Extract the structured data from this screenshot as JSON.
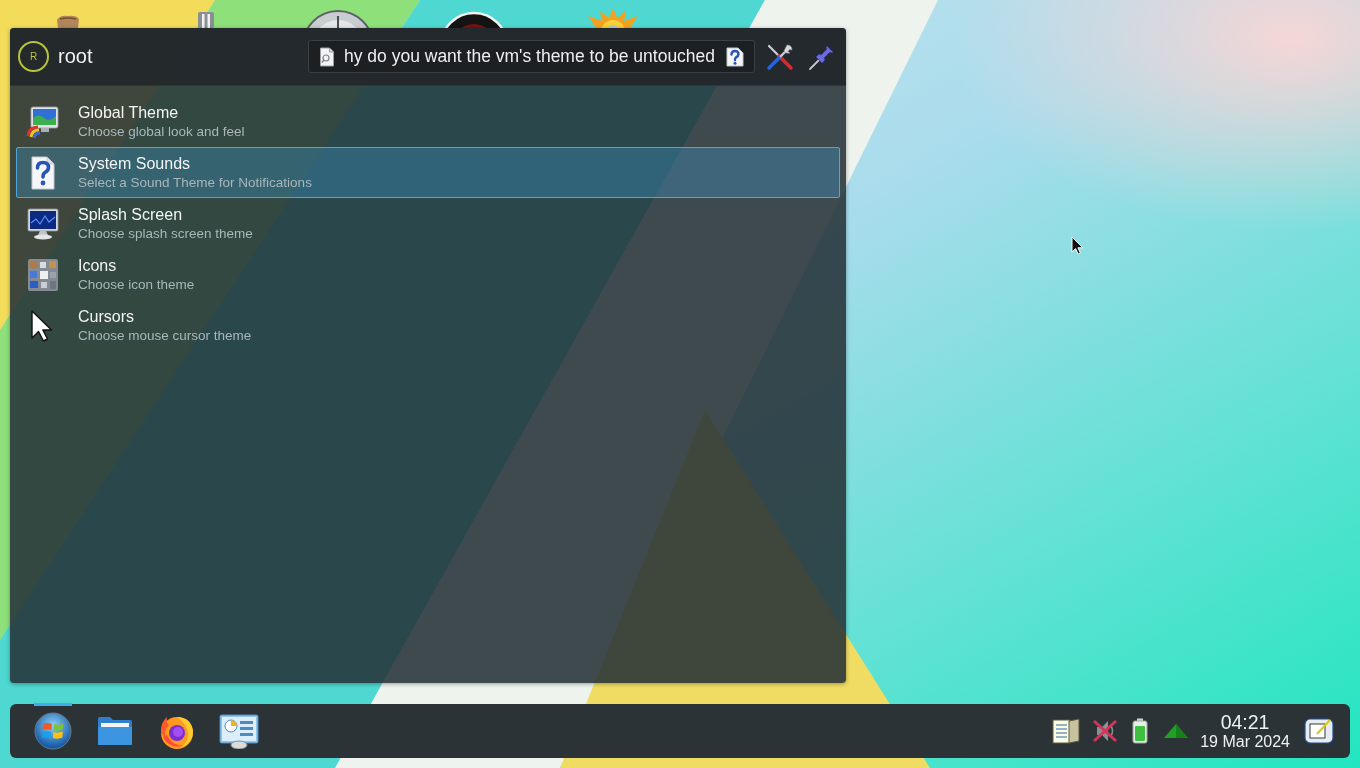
{
  "launcher": {
    "user": {
      "initial": "R",
      "name": "root"
    },
    "query": "hy do you want the vm's theme to be untouched",
    "results": [
      {
        "kind": "theme",
        "title": "Global Theme",
        "subtitle": "Choose global look and feel",
        "selected": false
      },
      {
        "kind": "sound",
        "title": "System Sounds",
        "subtitle": "Select a Sound Theme for Notifications",
        "selected": true
      },
      {
        "kind": "splash",
        "title": "Splash Screen",
        "subtitle": "Choose splash screen theme",
        "selected": false
      },
      {
        "kind": "icons",
        "title": "Icons",
        "subtitle": "Choose icon theme",
        "selected": false
      },
      {
        "kind": "cursor",
        "title": "Cursors",
        "subtitle": "Choose mouse cursor theme",
        "selected": false
      }
    ]
  },
  "taskbar": {
    "items": [
      {
        "kind": "start",
        "active": true
      },
      {
        "kind": "files",
        "active": false
      },
      {
        "kind": "browser",
        "active": false
      },
      {
        "kind": "settings",
        "active": false
      }
    ],
    "clock": {
      "time": "04:21",
      "date": "19 Mar 2024"
    }
  }
}
